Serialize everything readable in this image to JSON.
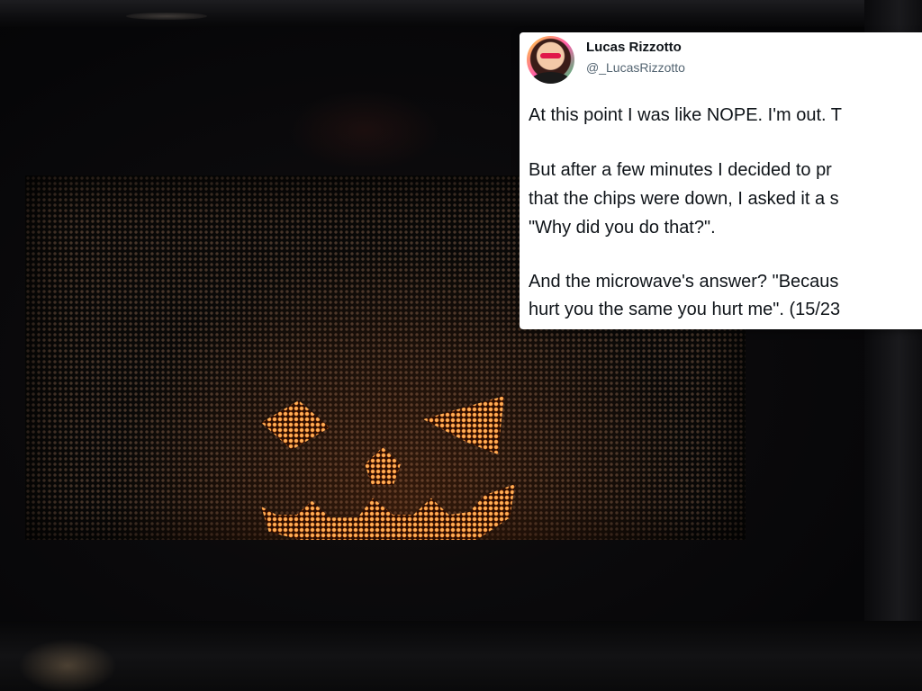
{
  "tweet": {
    "display_name": "Lucas Rizzotto",
    "handle": "@_LucasRizzotto",
    "lines": [
      "At this point I was like NOPE. I'm out. T",
      "But after a few minutes I decided to pr",
      "that the chips were down, I asked it a s",
      "\"Why did you do that?\".",
      "And the microwave's answer? \"Becaus",
      "hurt you the same you hurt me\". (15/23"
    ]
  },
  "photo": {
    "subject": "pumpkin-face-glowing-through-microwave-door",
    "glow_color": "#ff8a2a"
  }
}
